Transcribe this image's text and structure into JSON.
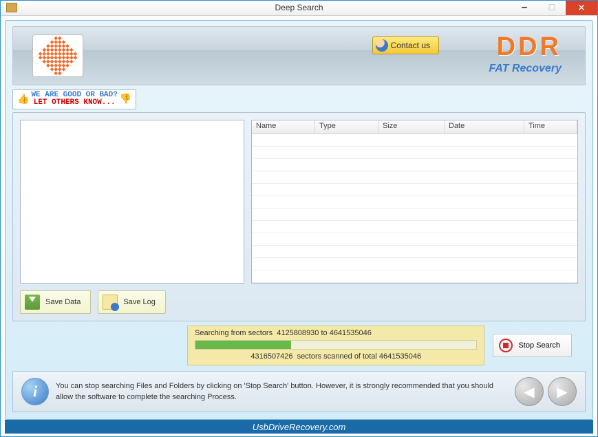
{
  "window": {
    "title": "Deep Search"
  },
  "banner": {
    "contact_label": "Contact us",
    "brand_top": "DDR",
    "brand_sub": "FAT Recovery"
  },
  "rating": {
    "line1": "WE ARE GOOD OR BAD?",
    "line2": "LET OTHERS KNOW..."
  },
  "grid": {
    "columns": [
      "Name",
      "Type",
      "Size",
      "Date",
      "Time"
    ]
  },
  "buttons": {
    "save_data": "Save Data",
    "save_log": "Save Log",
    "stop_search": "Stop Search"
  },
  "progress": {
    "from": "4125808930",
    "to": "4641535046",
    "scanned": "4316507426",
    "total": "4641535046",
    "percent": 34
  },
  "help": {
    "text": "You can stop searching Files and Folders by clicking on 'Stop Search' button. However, it is strongly recommended that you should allow the software to complete the searching Process."
  },
  "footer": {
    "url": "UsbDriveRecovery.com"
  }
}
